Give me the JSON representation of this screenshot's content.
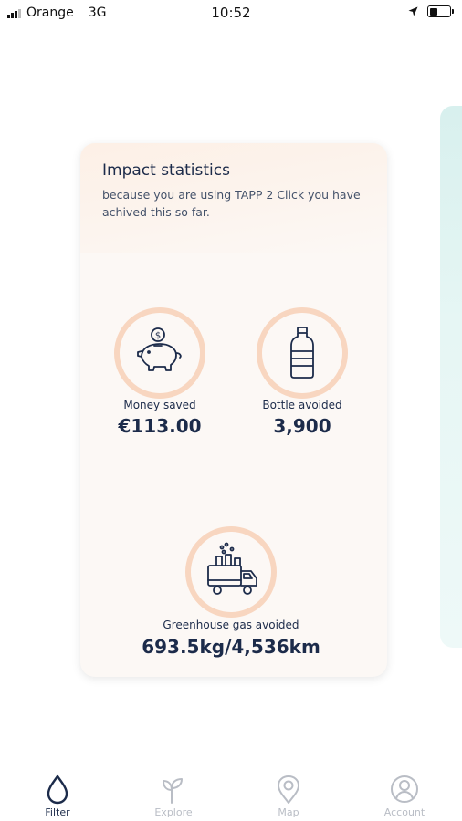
{
  "status_bar": {
    "carrier": "Orange",
    "network": "3G",
    "time": "10:52"
  },
  "card": {
    "title": "Impact statistics",
    "subtitle": "because you are using TAPP 2 Click you have achived this so far.",
    "stats": [
      {
        "icon": "piggy-bank-icon",
        "label": "Money saved",
        "value": "€113.00"
      },
      {
        "icon": "bottle-icon",
        "label": "Bottle avoided",
        "value": "3,900"
      },
      {
        "icon": "truck-factory-icon",
        "label": "Greenhouse gas avoided",
        "value": "693.5kg/4,536km"
      }
    ]
  },
  "nav": {
    "items": [
      {
        "label": "Filter",
        "icon": "drop-icon",
        "active": true
      },
      {
        "label": "Explore",
        "icon": "sprout-icon",
        "active": false
      },
      {
        "label": "Map",
        "icon": "map-pin-icon",
        "active": false
      },
      {
        "label": "Account",
        "icon": "account-icon",
        "active": false
      }
    ]
  },
  "colors": {
    "ring": "#f8d6c0",
    "ink": "#1c2b4a",
    "inactive": "#b9bdc5",
    "card_bg": "#fcf8f5"
  }
}
